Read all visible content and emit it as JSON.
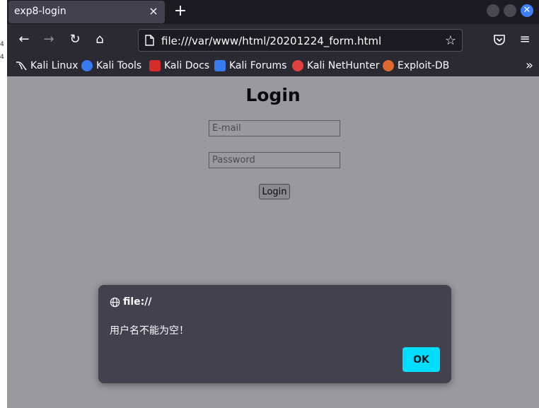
{
  "left_edge": {
    "markers": [
      "4",
      "4"
    ]
  },
  "tab": {
    "title": "exp8-login",
    "close_glyph": "×"
  },
  "new_tab_glyph": "+",
  "nav": {
    "back_glyph": "←",
    "forward_glyph": "→",
    "reload_glyph": "↻",
    "home_glyph": "⌂",
    "url": "file:///var/www/html/20201224_form.html",
    "star_glyph": "☆",
    "menu_glyph": "≡"
  },
  "bookmarks": [
    {
      "label": "Kali Linux",
      "icon": "kali-dragon-icon",
      "color": "#2b2a33"
    },
    {
      "label": "Kali Tools",
      "icon": "kali-tools-icon",
      "color": "#367bf0"
    },
    {
      "label": "Kali Docs",
      "icon": "kali-docs-icon",
      "color": "#d42b2b"
    },
    {
      "label": "Kali Forums",
      "icon": "kali-forums-icon",
      "color": "#367bf0"
    },
    {
      "label": "Kali NetHunter",
      "icon": "kali-nethunter-icon",
      "color": "#e04040"
    },
    {
      "label": "Exploit-DB",
      "icon": "exploit-db-icon",
      "color": "#e0692f"
    }
  ],
  "bookmarks_more_glyph": "»",
  "page": {
    "title": "Login",
    "email_placeholder": "E-mail",
    "password_placeholder": "Password",
    "login_button": "Login"
  },
  "dialog": {
    "origin": "file://",
    "message": "用户名不能为空！",
    "ok_label": "OK"
  },
  "colors": {
    "accent": "#00ddff",
    "toolbar": "#2b2a33",
    "dialog_bg": "#42414d",
    "page_overlay": "#9a999e"
  }
}
